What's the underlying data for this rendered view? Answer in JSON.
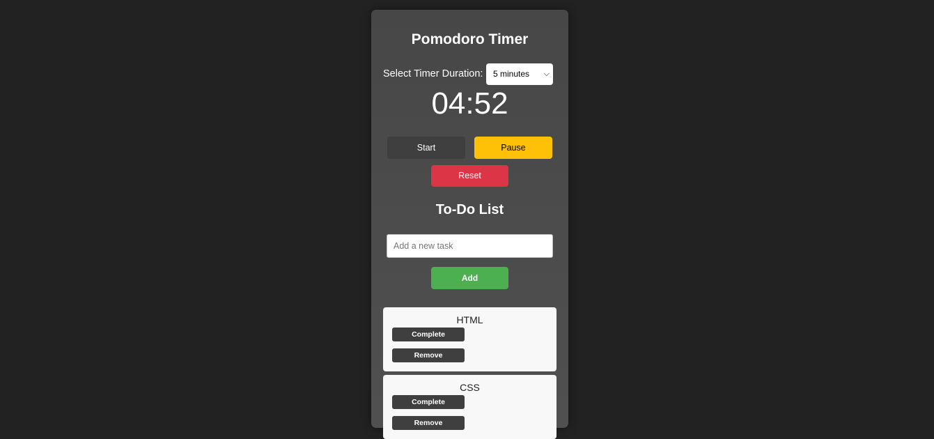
{
  "app": {
    "title": "Pomodoro Timer"
  },
  "timer": {
    "duration_label": "Select Timer Duration:",
    "duration_selected": "5 minutes",
    "display": "04:52",
    "start_label": "Start",
    "pause_label": "Pause",
    "reset_label": "Reset"
  },
  "todo": {
    "title": "To-Do List",
    "input_placeholder": "Add a new task",
    "add_label": "Add",
    "tasks": [
      {
        "name": "HTML",
        "complete_label": "Complete",
        "remove_label": "Remove"
      },
      {
        "name": "CSS",
        "complete_label": "Complete",
        "remove_label": "Remove"
      }
    ]
  },
  "colors": {
    "background": "#222222",
    "card": "#4a4a4a",
    "pause": "#ffc107",
    "reset": "#dc3545",
    "add": "#4caf50",
    "dark_button": "#3f3f3f"
  }
}
